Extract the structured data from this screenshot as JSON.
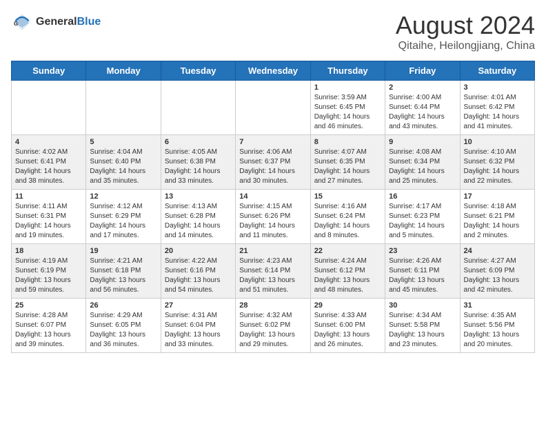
{
  "header": {
    "logo_general": "General",
    "logo_blue": "Blue",
    "month_title": "August 2024",
    "location": "Qitaihe, Heilongjiang, China"
  },
  "days_of_week": [
    "Sunday",
    "Monday",
    "Tuesday",
    "Wednesday",
    "Thursday",
    "Friday",
    "Saturday"
  ],
  "weeks": [
    [
      {
        "day": "",
        "info": ""
      },
      {
        "day": "",
        "info": ""
      },
      {
        "day": "",
        "info": ""
      },
      {
        "day": "",
        "info": ""
      },
      {
        "day": "1",
        "info": "Sunrise: 3:59 AM\nSunset: 6:45 PM\nDaylight: 14 hours\nand 46 minutes."
      },
      {
        "day": "2",
        "info": "Sunrise: 4:00 AM\nSunset: 6:44 PM\nDaylight: 14 hours\nand 43 minutes."
      },
      {
        "day": "3",
        "info": "Sunrise: 4:01 AM\nSunset: 6:42 PM\nDaylight: 14 hours\nand 41 minutes."
      }
    ],
    [
      {
        "day": "4",
        "info": "Sunrise: 4:02 AM\nSunset: 6:41 PM\nDaylight: 14 hours\nand 38 minutes."
      },
      {
        "day": "5",
        "info": "Sunrise: 4:04 AM\nSunset: 6:40 PM\nDaylight: 14 hours\nand 35 minutes."
      },
      {
        "day": "6",
        "info": "Sunrise: 4:05 AM\nSunset: 6:38 PM\nDaylight: 14 hours\nand 33 minutes."
      },
      {
        "day": "7",
        "info": "Sunrise: 4:06 AM\nSunset: 6:37 PM\nDaylight: 14 hours\nand 30 minutes."
      },
      {
        "day": "8",
        "info": "Sunrise: 4:07 AM\nSunset: 6:35 PM\nDaylight: 14 hours\nand 27 minutes."
      },
      {
        "day": "9",
        "info": "Sunrise: 4:08 AM\nSunset: 6:34 PM\nDaylight: 14 hours\nand 25 minutes."
      },
      {
        "day": "10",
        "info": "Sunrise: 4:10 AM\nSunset: 6:32 PM\nDaylight: 14 hours\nand 22 minutes."
      }
    ],
    [
      {
        "day": "11",
        "info": "Sunrise: 4:11 AM\nSunset: 6:31 PM\nDaylight: 14 hours\nand 19 minutes."
      },
      {
        "day": "12",
        "info": "Sunrise: 4:12 AM\nSunset: 6:29 PM\nDaylight: 14 hours\nand 17 minutes."
      },
      {
        "day": "13",
        "info": "Sunrise: 4:13 AM\nSunset: 6:28 PM\nDaylight: 14 hours\nand 14 minutes."
      },
      {
        "day": "14",
        "info": "Sunrise: 4:15 AM\nSunset: 6:26 PM\nDaylight: 14 hours\nand 11 minutes."
      },
      {
        "day": "15",
        "info": "Sunrise: 4:16 AM\nSunset: 6:24 PM\nDaylight: 14 hours\nand 8 minutes."
      },
      {
        "day": "16",
        "info": "Sunrise: 4:17 AM\nSunset: 6:23 PM\nDaylight: 14 hours\nand 5 minutes."
      },
      {
        "day": "17",
        "info": "Sunrise: 4:18 AM\nSunset: 6:21 PM\nDaylight: 14 hours\nand 2 minutes."
      }
    ],
    [
      {
        "day": "18",
        "info": "Sunrise: 4:19 AM\nSunset: 6:19 PM\nDaylight: 13 hours\nand 59 minutes."
      },
      {
        "day": "19",
        "info": "Sunrise: 4:21 AM\nSunset: 6:18 PM\nDaylight: 13 hours\nand 56 minutes."
      },
      {
        "day": "20",
        "info": "Sunrise: 4:22 AM\nSunset: 6:16 PM\nDaylight: 13 hours\nand 54 minutes."
      },
      {
        "day": "21",
        "info": "Sunrise: 4:23 AM\nSunset: 6:14 PM\nDaylight: 13 hours\nand 51 minutes."
      },
      {
        "day": "22",
        "info": "Sunrise: 4:24 AM\nSunset: 6:12 PM\nDaylight: 13 hours\nand 48 minutes."
      },
      {
        "day": "23",
        "info": "Sunrise: 4:26 AM\nSunset: 6:11 PM\nDaylight: 13 hours\nand 45 minutes."
      },
      {
        "day": "24",
        "info": "Sunrise: 4:27 AM\nSunset: 6:09 PM\nDaylight: 13 hours\nand 42 minutes."
      }
    ],
    [
      {
        "day": "25",
        "info": "Sunrise: 4:28 AM\nSunset: 6:07 PM\nDaylight: 13 hours\nand 39 minutes."
      },
      {
        "day": "26",
        "info": "Sunrise: 4:29 AM\nSunset: 6:05 PM\nDaylight: 13 hours\nand 36 minutes."
      },
      {
        "day": "27",
        "info": "Sunrise: 4:31 AM\nSunset: 6:04 PM\nDaylight: 13 hours\nand 33 minutes."
      },
      {
        "day": "28",
        "info": "Sunrise: 4:32 AM\nSunset: 6:02 PM\nDaylight: 13 hours\nand 29 minutes."
      },
      {
        "day": "29",
        "info": "Sunrise: 4:33 AM\nSunset: 6:00 PM\nDaylight: 13 hours\nand 26 minutes."
      },
      {
        "day": "30",
        "info": "Sunrise: 4:34 AM\nSunset: 5:58 PM\nDaylight: 13 hours\nand 23 minutes."
      },
      {
        "day": "31",
        "info": "Sunrise: 4:35 AM\nSunset: 5:56 PM\nDaylight: 13 hours\nand 20 minutes."
      }
    ]
  ]
}
